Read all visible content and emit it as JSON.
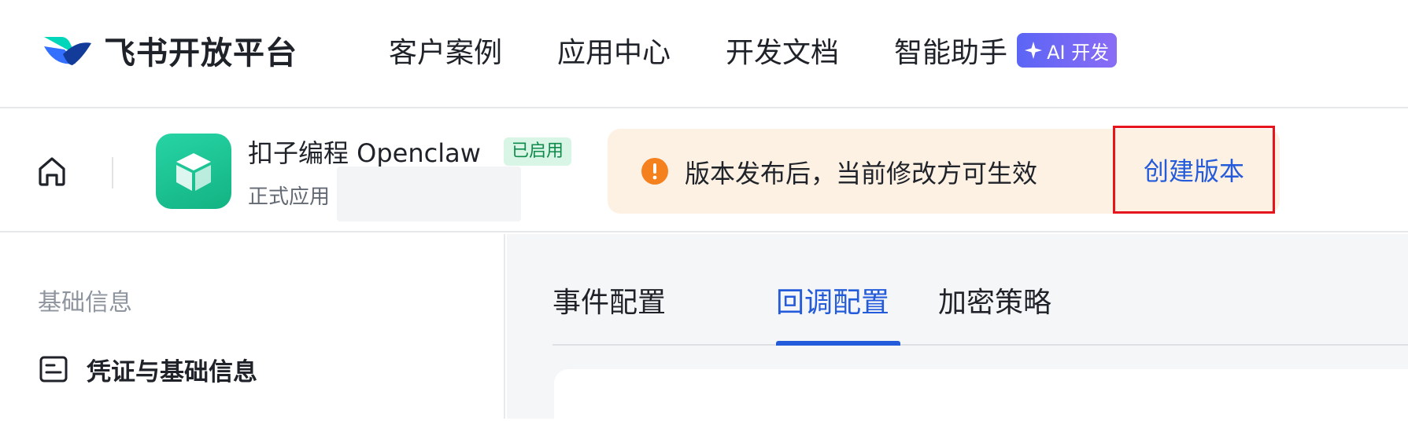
{
  "brand": {
    "name": "飞书开放平台",
    "logo_icon": "feishu-logo-icon"
  },
  "nav": {
    "items": [
      "客户案例",
      "应用中心",
      "开发文档",
      "智能助手"
    ],
    "ai_badge": "AI 开发",
    "ai_badge_icon": "sparkle-icon"
  },
  "app": {
    "name": "扣子编程 Openclaw",
    "status": "已启用",
    "type": "正式应用",
    "icon": "cube-icon"
  },
  "notice": {
    "text": "版本发布后，当前修改方可生效",
    "icon": "exclamation-circle-icon",
    "action": "创建版本"
  },
  "sidebar": {
    "group_title": "基础信息",
    "items": [
      {
        "label": "凭证与基础信息",
        "icon": "credential-card-icon"
      }
    ]
  },
  "tabs": {
    "items": [
      {
        "label": "事件配置",
        "active": false
      },
      {
        "label": "回调配置",
        "active": true
      },
      {
        "label": "加密策略",
        "active": false
      }
    ]
  },
  "colors": {
    "accent": "#245bdb",
    "highlight_border": "#e6141c",
    "notice_bg": "#fdf1e4",
    "notice_icon": "#f5801e",
    "status_bg": "#d9f5e6",
    "status_text": "#0e8a4a",
    "app_icon_bg": "#1ec593",
    "ai_badge": "#6b68f5"
  }
}
